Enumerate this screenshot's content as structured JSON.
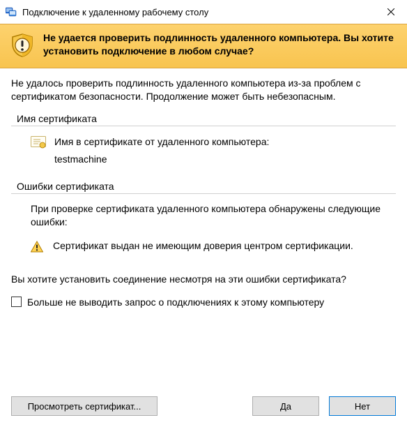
{
  "titlebar": {
    "title": "Подключение к удаленному рабочему столу"
  },
  "banner": {
    "message": "Не удается проверить подлинность удаленного компьютера. Вы хотите установить подключение в любом случае?"
  },
  "intro": "Не удалось проверить подлинность удаленного компьютера из-за проблем с сертификатом безопасности. Продолжение может быть небезопасным.",
  "cert_group": {
    "title": "Имя сертификата",
    "label": "Имя в сертификате от удаленного компьютера:",
    "value": "testmachine"
  },
  "err_group": {
    "title": "Ошибки сертификата",
    "intro": "При проверке сертификата удаленного компьютера обнаружены следующие ошибки:",
    "item": "Сертификат выдан не имеющим доверия центром сертификации."
  },
  "question": "Вы хотите установить соединение несмотря на эти ошибки сертификата?",
  "checkbox_label": "Больше не выводить запрос о подключениях к этому компьютеру",
  "buttons": {
    "view_cert": "Просмотреть сертификат...",
    "yes": "Да",
    "no": "Нет"
  }
}
